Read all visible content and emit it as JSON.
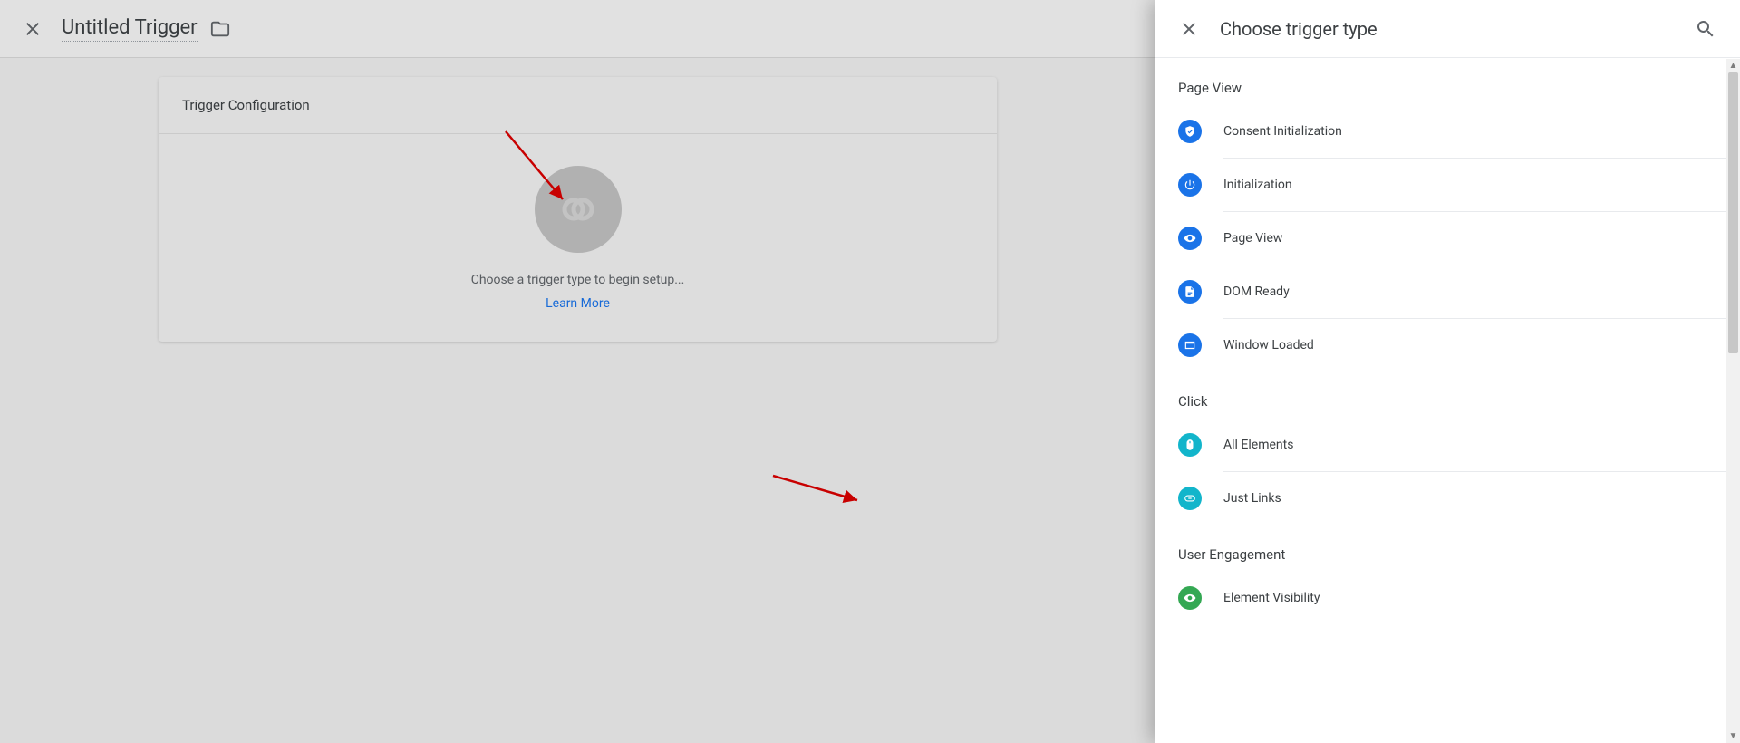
{
  "background": {
    "title": "Untitled Trigger",
    "card_heading": "Trigger Configuration",
    "hint": "Choose a trigger type to begin setup...",
    "learn_more": "Learn More"
  },
  "panel": {
    "title": "Choose trigger type",
    "sections": [
      {
        "label": "Page View",
        "items": [
          {
            "name": "Consent Initialization",
            "icon": "shield",
            "color": "c-blue"
          },
          {
            "name": "Initialization",
            "icon": "power",
            "color": "c-blue"
          },
          {
            "name": "Page View",
            "icon": "eye",
            "color": "c-blue"
          },
          {
            "name": "DOM Ready",
            "icon": "doc",
            "color": "c-blue"
          },
          {
            "name": "Window Loaded",
            "icon": "window",
            "color": "c-blue"
          }
        ]
      },
      {
        "label": "Click",
        "items": [
          {
            "name": "All Elements",
            "icon": "mouse",
            "color": "c-cyan"
          },
          {
            "name": "Just Links",
            "icon": "link",
            "color": "c-cyan"
          }
        ]
      },
      {
        "label": "User Engagement",
        "items": [
          {
            "name": "Element Visibility",
            "icon": "eye",
            "color": "c-green"
          }
        ]
      }
    ]
  }
}
